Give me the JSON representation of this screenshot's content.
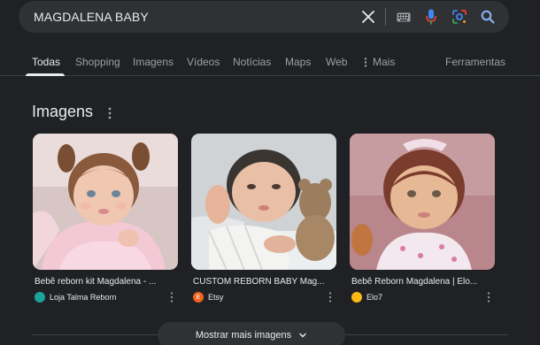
{
  "search": {
    "query": "MAGDALENA BABY"
  },
  "tabs": [
    {
      "label": "Todas",
      "active": true
    },
    {
      "label": "Shopping"
    },
    {
      "label": "Imagens"
    },
    {
      "label": "Vídeos"
    },
    {
      "label": "Notícias"
    },
    {
      "label": "Maps"
    },
    {
      "label": "Web"
    },
    {
      "label": "Mais"
    }
  ],
  "tools_label": "Ferramentas",
  "section": {
    "title": "Imagens"
  },
  "images": [
    {
      "title": "Bebê reborn kit Magdalena - ...",
      "source": "Loja Talma Reborn",
      "favicon_color": "#1aa39a"
    },
    {
      "title": "CUSTOM REBORN BABY Mag...",
      "source": "Etsy",
      "favicon_color": "#f1641e",
      "favicon_letter": "E"
    },
    {
      "title": "Bebê Reborn Magdalena | Elo...",
      "source": "Elo7",
      "favicon_color": "#fdb913"
    }
  ],
  "show_more_label": "Mostrar mais imagens",
  "colors": {
    "background": "#202124",
    "surface": "#303134",
    "text": "#e8eaed",
    "muted": "#9aa0a6",
    "mic_blue": "#4285f4",
    "search_icon_blue": "#8ab4f8"
  },
  "icons": [
    "clear-icon",
    "keyboard-icon",
    "mic-icon",
    "lens-icon",
    "search-icon",
    "more-vert-icon",
    "chevron-down-icon"
  ]
}
